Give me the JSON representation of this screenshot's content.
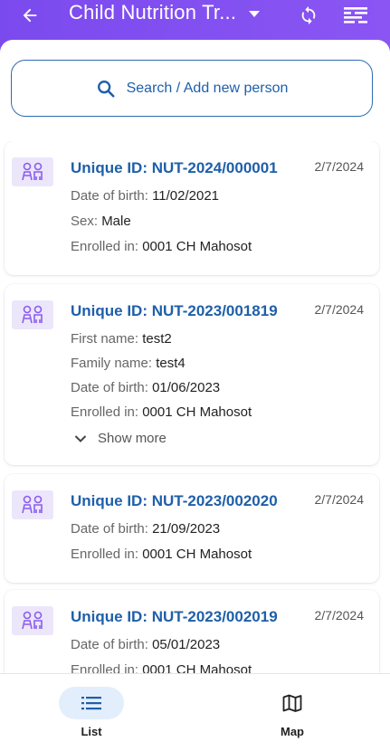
{
  "header": {
    "title": "Child Nutrition Tr...",
    "icons": [
      "back-arrow-icon",
      "dropdown-caret-icon",
      "sync-icon",
      "filter-list-icon"
    ]
  },
  "search": {
    "label": "Search / Add new person"
  },
  "records": [
    {
      "uid": "Unique ID: NUT-2024/000001",
      "date": "2/7/2024",
      "fields": [
        {
          "k": "Date of birth:",
          "v": "11/02/2021"
        },
        {
          "k": "Sex:",
          "v": "Male"
        },
        {
          "k": "Enrolled in:",
          "v": "0001 CH Mahosot"
        }
      ]
    },
    {
      "uid": "Unique ID: NUT-2023/001819",
      "date": "2/7/2024",
      "fields": [
        {
          "k": "First name:",
          "v": "test2"
        },
        {
          "k": "Family name:",
          "v": "test4"
        },
        {
          "k": "Date of birth:",
          "v": "01/06/2023"
        },
        {
          "k": "Enrolled in:",
          "v": "0001 CH Mahosot"
        }
      ],
      "show_more": "Show more"
    },
    {
      "uid": "Unique ID: NUT-2023/002020",
      "date": "2/7/2024",
      "fields": [
        {
          "k": "Date of birth:",
          "v": "21/09/2023"
        },
        {
          "k": "Enrolled in:",
          "v": "0001 CH Mahosot"
        }
      ]
    },
    {
      "uid": "Unique ID: NUT-2023/002019",
      "date": "2/7/2024",
      "fields": [
        {
          "k": "Date of birth:",
          "v": "05/01/2023"
        },
        {
          "k": "Enrolled in:",
          "v": "0001 CH Mahosot"
        }
      ]
    }
  ],
  "bottom_nav": {
    "list_label": "List",
    "map_label": "Map",
    "active": "List"
  },
  "colors": {
    "header": "#7b4dee",
    "primary_text": "#1f5fa9",
    "avatar_bg": "#ece6fb",
    "active_tab_bg": "#e3eefc"
  }
}
